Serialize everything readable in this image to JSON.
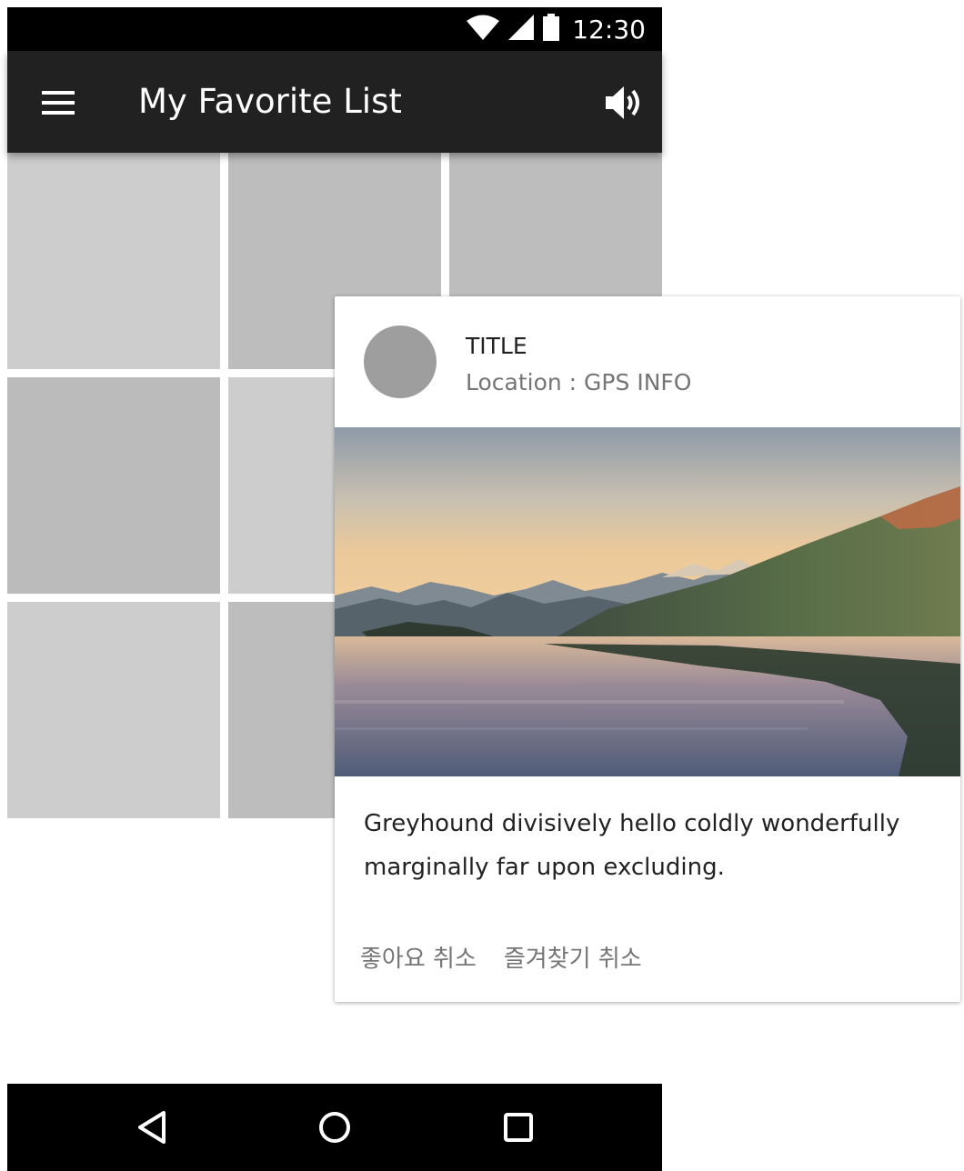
{
  "status_bar": {
    "time": "12:30",
    "icons": [
      "wifi-icon",
      "signal-icon",
      "battery-icon"
    ]
  },
  "app_bar": {
    "title": "My Favorite List",
    "left_icon": "menu-icon",
    "right_icon": "volume-icon"
  },
  "colors": {
    "app_bar": "#212121",
    "status_bar": "#000000",
    "tile_light": "#cdcdcd",
    "tile_dark": "#bdbdbd",
    "avatar": "#9e9e9e"
  },
  "card": {
    "title": "TITLE",
    "subtitle": "Location : GPS INFO",
    "body": "Greyhound divisively hello coldly wonderfully marginally far upon excluding.",
    "actions": [
      "좋아요 취소",
      "즐겨찾기 취소"
    ]
  },
  "nav_bar": {
    "icons": [
      "back-icon",
      "home-icon",
      "recents-icon"
    ]
  }
}
